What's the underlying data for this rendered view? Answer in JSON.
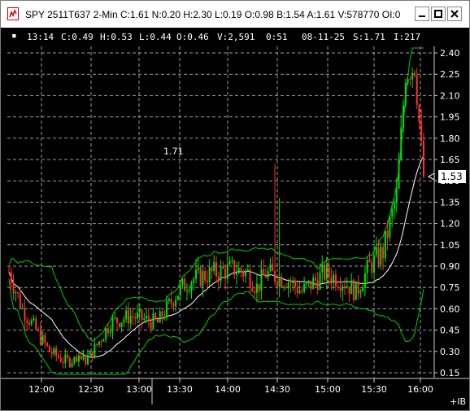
{
  "window": {
    "title": "SPY 2511T637 2-Min C:1.61 N:0.20 H:2.30 L:0.19 O:0.98 B:1.54 A:1.61 V:578770 OI:0"
  },
  "info_bar": {
    "time": "13:14",
    "close": "C:0.49",
    "high": "H:0.53",
    "low": "L:0.44",
    "open": "O:0.46",
    "volume": "V:2,591",
    "bar_time": "0:51",
    "date": "08-11-25",
    "s": "S:1.71",
    "i": "I:217"
  },
  "chart_text": {
    "hline_label": "1.71",
    "last_price": "1.53",
    "ib_marker": "+IB"
  },
  "colors": {
    "up": "#00e000",
    "down": "#ff3030",
    "band": "#00cc00",
    "ma": "#ffffff",
    "grid": "#9a9a9a"
  },
  "chart_data": {
    "type": "candlestick",
    "title": "",
    "price_ticks": [
      "2.40",
      "2.25",
      "2.10",
      "1.95",
      "1.80",
      "1.65",
      "1.50",
      "1.35",
      "1.20",
      "1.05",
      "0.90",
      "0.75",
      "0.60",
      "0.45",
      "0.30",
      "0.15"
    ],
    "time_ticks": [
      "12:00",
      "12:30",
      "13:00",
      "13:30",
      "14:00",
      "14:30",
      "15:00",
      "15:30",
      "16:00"
    ],
    "ylim": [
      0.15,
      2.4
    ],
    "price_line": 1.71,
    "last_price": 1.53,
    "series": [
      {
        "name": "price",
        "description": "2-minute OHLC bars, starting around 0.85, dropping to ~0.22 near 12:30, rising to ~0.7-0.9 through mid-afternoon, then spiking to ~2.30 just before 16:00 and closing ~1.53"
      }
    ],
    "grid": true
  }
}
